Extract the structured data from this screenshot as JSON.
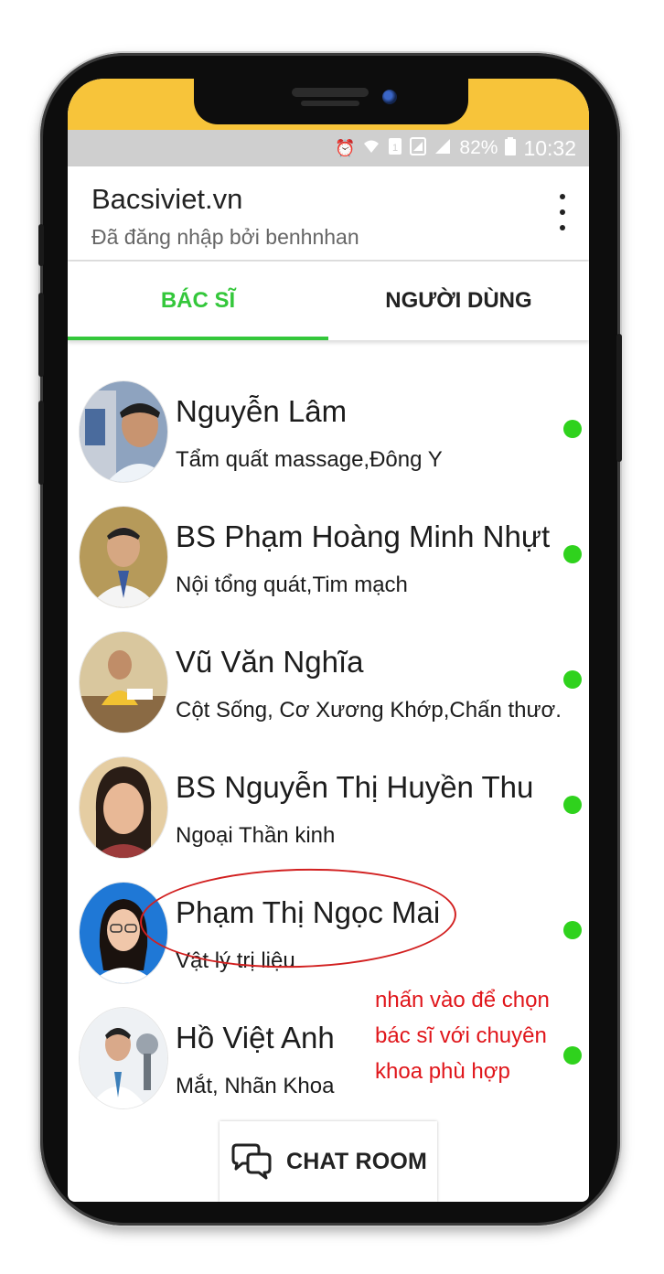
{
  "status_bar": {
    "battery": "82%",
    "time": "10:32",
    "icons": [
      "alarm-icon",
      "wifi-icon",
      "sim-icon",
      "sim2-icon",
      "signal-icon",
      "battery-icon"
    ]
  },
  "app_bar": {
    "title": "Bacsiviet.vn",
    "subtitle": "Đã đăng nhập bởi benhnhan",
    "menu_icon": "more-vertical-icon"
  },
  "tabs": [
    {
      "label": "BÁC SĨ",
      "active": true
    },
    {
      "label": "NGƯỜI DÙNG",
      "active": false
    }
  ],
  "doctors": [
    {
      "name": "Nguyễn Lâm",
      "specialty": "Tẩm quất massage,Đông Y",
      "online": true
    },
    {
      "name": "BS Phạm Hoàng Minh Nhựt",
      "specialty": "Nội tổng quát,Tim  mạch",
      "online": true
    },
    {
      "name": "Vũ Văn Nghĩa",
      "specialty": "Cột Sống, Cơ Xương Khớp,Chấn thươ...",
      "online": true
    },
    {
      "name": "BS Nguyễn Thị Huyền Thu",
      "specialty": "Ngoại Thần kinh",
      "online": true
    },
    {
      "name": "Phạm Thị Ngọc Mai",
      "specialty": "Vật lý trị liệu",
      "online": true
    },
    {
      "name": "Hồ Việt Anh",
      "specialty": "Mắt, Nhãn Khoa",
      "online": true
    }
  ],
  "annotation": {
    "lines": [
      "nhấn vào để chọn",
      "bác sĩ với chuyên",
      "khoa phù hợp"
    ],
    "color": "#e0161b"
  },
  "chat_room": {
    "label": "CHAT ROOM",
    "icon": "chat-bubbles-icon"
  },
  "colors": {
    "accent": "#34c73b",
    "online": "#2fd21d",
    "wallpaper": "#f7c43a"
  }
}
